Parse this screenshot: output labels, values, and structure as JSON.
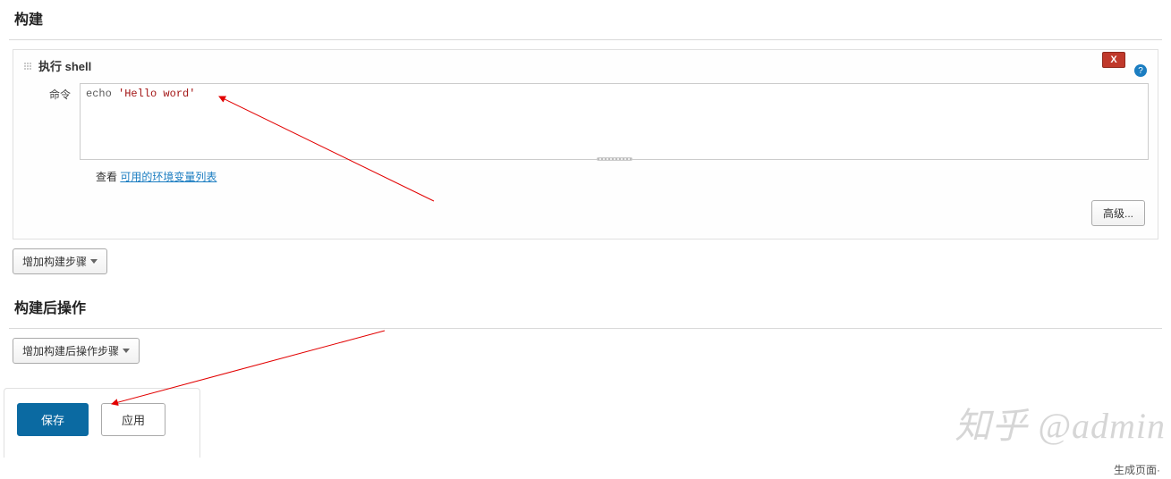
{
  "build": {
    "title": "构建",
    "step_title": "执行 shell",
    "cmd_label": "命令",
    "cmd_echo": "echo",
    "cmd_str": "'Hello word'",
    "env_prefix": "查看",
    "env_link": "可用的环境变量列表",
    "advanced_btn": "高级...",
    "add_step_btn": "增加构建步骤",
    "close_btn": "X"
  },
  "postbuild": {
    "title": "构建后操作",
    "add_step_btn": "增加构建后操作步骤"
  },
  "footer": {
    "save": "保存",
    "apply": "应用"
  },
  "misc": {
    "bottom_right": "生成页面·",
    "watermark": "知乎 @admin"
  }
}
